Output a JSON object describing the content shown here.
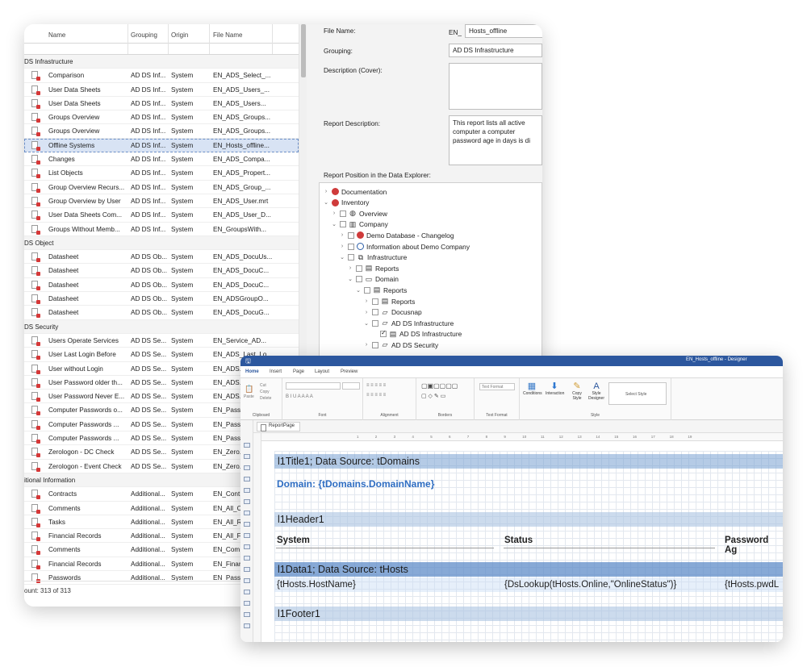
{
  "list": {
    "columns": [
      "Name",
      "Grouping",
      "Origin",
      "File Name"
    ],
    "groups": [
      {
        "label": "DS Infrastructure",
        "rows": [
          {
            "name": "Comparison",
            "grouping": "AD DS Inf...",
            "origin": "System",
            "file": "EN_ADS_Select_..."
          },
          {
            "name": "User Data Sheets",
            "grouping": "AD DS Inf...",
            "origin": "System",
            "file": "EN_ADS_Users_..."
          },
          {
            "name": "User Data Sheets",
            "grouping": "AD DS Inf...",
            "origin": "System",
            "file": "EN_ADS_Users..."
          },
          {
            "name": "Groups Overview",
            "grouping": "AD DS Inf...",
            "origin": "System",
            "file": "EN_ADS_Groups..."
          },
          {
            "name": "Groups Overview",
            "grouping": "AD DS Inf...",
            "origin": "System",
            "file": "EN_ADS_Groups..."
          },
          {
            "name": "Offline Systems",
            "grouping": "AD DS Inf...",
            "origin": "System",
            "file": "EN_Hosts_offline...",
            "selected": true
          },
          {
            "name": "Changes",
            "grouping": "AD DS Inf...",
            "origin": "System",
            "file": "EN_ADS_Compa..."
          },
          {
            "name": "List Objects",
            "grouping": "AD DS Inf...",
            "origin": "System",
            "file": "EN_ADS_Propert..."
          },
          {
            "name": "Group Overview Recurs...",
            "grouping": "AD DS Inf...",
            "origin": "System",
            "file": "EN_ADS_Group_..."
          },
          {
            "name": "Group Overview by User",
            "grouping": "AD DS Inf...",
            "origin": "System",
            "file": "EN_ADS_User.mrt"
          },
          {
            "name": "User Data Sheets Com...",
            "grouping": "AD DS Inf...",
            "origin": "System",
            "file": "EN_ADS_User_D..."
          },
          {
            "name": "Groups Without Memb...",
            "grouping": "AD DS Inf...",
            "origin": "System",
            "file": "EN_GroupsWith..."
          }
        ]
      },
      {
        "label": "DS Object",
        "rows": [
          {
            "name": "Datasheet",
            "grouping": "AD DS Ob...",
            "origin": "System",
            "file": "EN_ADS_DocuUs..."
          },
          {
            "name": "Datasheet",
            "grouping": "AD DS Ob...",
            "origin": "System",
            "file": "EN_ADS_DocuC..."
          },
          {
            "name": "Datasheet",
            "grouping": "AD DS Ob...",
            "origin": "System",
            "file": "EN_ADS_DocuC..."
          },
          {
            "name": "Datasheet",
            "grouping": "AD DS Ob...",
            "origin": "System",
            "file": "EN_ADSGroupO..."
          },
          {
            "name": "Datasheet",
            "grouping": "AD DS Ob...",
            "origin": "System",
            "file": "EN_ADS_DocuG..."
          }
        ]
      },
      {
        "label": "DS Security",
        "rows": [
          {
            "name": "Users Operate Services",
            "grouping": "AD DS Se...",
            "origin": "System",
            "file": "EN_Service_AD..."
          },
          {
            "name": "User Last Login Before",
            "grouping": "AD DS Se...",
            "origin": "System",
            "file": "EN_ADS_Last_Lo..."
          },
          {
            "name": "User without Login",
            "grouping": "AD DS Se...",
            "origin": "System",
            "file": "EN_ADS..."
          },
          {
            "name": "User Password older th...",
            "grouping": "AD DS Se...",
            "origin": "System",
            "file": "EN_ADS..."
          },
          {
            "name": "User Password Never E...",
            "grouping": "AD DS Se...",
            "origin": "System",
            "file": "EN_ADS..."
          },
          {
            "name": "Computer Passwords o...",
            "grouping": "AD DS Se...",
            "origin": "System",
            "file": "EN_Pass..."
          },
          {
            "name": "Computer Passwords ...",
            "grouping": "AD DS Se...",
            "origin": "System",
            "file": "EN_Pass..."
          },
          {
            "name": "Computer Passwords ...",
            "grouping": "AD DS Se...",
            "origin": "System",
            "file": "EN_Pass..."
          },
          {
            "name": "Zerologon - DC Check",
            "grouping": "AD DS Se...",
            "origin": "System",
            "file": "EN_Zero..."
          },
          {
            "name": "Zerologon - Event Check",
            "grouping": "AD DS Se...",
            "origin": "System",
            "file": "EN_Zero..."
          }
        ]
      },
      {
        "label": "itional Information",
        "rows": [
          {
            "name": "Contracts",
            "grouping": "Additional...",
            "origin": "System",
            "file": "EN_Cont..."
          },
          {
            "name": "Comments",
            "grouping": "Additional...",
            "origin": "System",
            "file": "EN_All_C..."
          },
          {
            "name": "Tasks",
            "grouping": "Additional...",
            "origin": "System",
            "file": "EN_All_R..."
          },
          {
            "name": "Financial Records",
            "grouping": "Additional...",
            "origin": "System",
            "file": "EN_All_F..."
          },
          {
            "name": "Comments",
            "grouping": "Additional...",
            "origin": "System",
            "file": "EN_Com..."
          },
          {
            "name": "Financial Records",
            "grouping": "Additional...",
            "origin": "System",
            "file": "EN_Finar..."
          },
          {
            "name": "Passwords",
            "grouping": "Additional...",
            "origin": "System",
            "file": "EN_Pass..."
          }
        ]
      }
    ],
    "count": "ount: 313 of 313"
  },
  "details": {
    "file_name_label": "File Name:",
    "file_prefix": "EN_",
    "file_name": "Hosts_offline",
    "grouping_label": "Grouping:",
    "grouping": "AD DS Infrastructure",
    "description_cover_label": "Description (Cover):",
    "report_description_label": "Report Description:",
    "report_description": "This report lists all active computer a computer password age in days is di",
    "position_label": "Report Position in the Data Explorer:",
    "tree": [
      {
        "label": "Documentation",
        "chev": "›",
        "icon": "red",
        "check": false,
        "cb": false
      },
      {
        "label": "Inventory",
        "chev": "⌄",
        "icon": "red",
        "check": false,
        "cb": false
      },
      {
        "label": "Overview",
        "chev": "›",
        "icon": "globe",
        "cb": true
      },
      {
        "label": "Company",
        "chev": "⌄",
        "icon": "building",
        "cb": true
      },
      {
        "label": "Demo Database - Changelog",
        "chev": "›",
        "icon": "red",
        "cb": true
      },
      {
        "label": "Information about Demo Company",
        "chev": "›",
        "icon": "info",
        "cb": true
      },
      {
        "label": "Infrastructure",
        "chev": "⌄",
        "icon": "net",
        "cb": true
      },
      {
        "label": "Reports",
        "chev": "›",
        "icon": "doc",
        "cb": true
      },
      {
        "label": "Domain",
        "chev": "⌄",
        "icon": "monitor",
        "cb": true
      },
      {
        "label": "Reports",
        "chev": "⌄",
        "icon": "doc",
        "cb": true
      },
      {
        "label": "Reports",
        "chev": "›",
        "icon": "doc",
        "cb": true
      },
      {
        "label": "Docusnap",
        "chev": "›",
        "icon": "folder",
        "cb": true
      },
      {
        "label": "AD DS Infrastructure",
        "chev": "⌄",
        "icon": "folder",
        "cb": true
      },
      {
        "label": "AD DS Infrastructure",
        "chev": "",
        "icon": "doc",
        "cb": true,
        "checked": true
      },
      {
        "label": "AD DS Security",
        "chev": "›",
        "icon": "folder",
        "cb": true
      }
    ]
  },
  "designer": {
    "title": "EN_Hosts_offline - Designer",
    "tabs": [
      "Home",
      "Insert",
      "Page",
      "Layout",
      "Preview"
    ],
    "ribbon": {
      "clipboard": {
        "label": "Clipboard",
        "cut": "Cut",
        "copy": "Copy",
        "delete": "Delete",
        "paste": "Paste"
      },
      "font": "Font",
      "alignment": "Alignment",
      "borders": "Borders",
      "text_format": {
        "label": "Text Format",
        "placeholder": "Text Format"
      },
      "style": {
        "label": "Style",
        "conditions": "Conditions",
        "interaction": "Interaction",
        "copy_style": "Copy Style",
        "style_designer": "Style Designer",
        "select_style": "Select Style"
      }
    },
    "doc_tab": "ReportPage",
    "ruler_ticks": [
      "1",
      "2",
      "3",
      "4",
      "5",
      "6",
      "7",
      "8",
      "9",
      "10",
      "11",
      "12",
      "13",
      "14",
      "15",
      "16",
      "17",
      "18",
      "19"
    ],
    "bands": {
      "title": "l1Title1; Data Source: tDomains",
      "domain": "Domain: {tDomains.DomainName}",
      "header": "l1Header1",
      "col_system": "System",
      "col_status": "Status",
      "col_pwd": "Password Ag",
      "data": "l1Data1; Data Source: tHosts",
      "host": "{tHosts.HostName}",
      "status_expr": "{DsLookup(tHosts.Online,\"OnlineStatus\")}",
      "pwd_expr": "{tHosts.pwdL",
      "footer": "l1Footer1"
    }
  }
}
